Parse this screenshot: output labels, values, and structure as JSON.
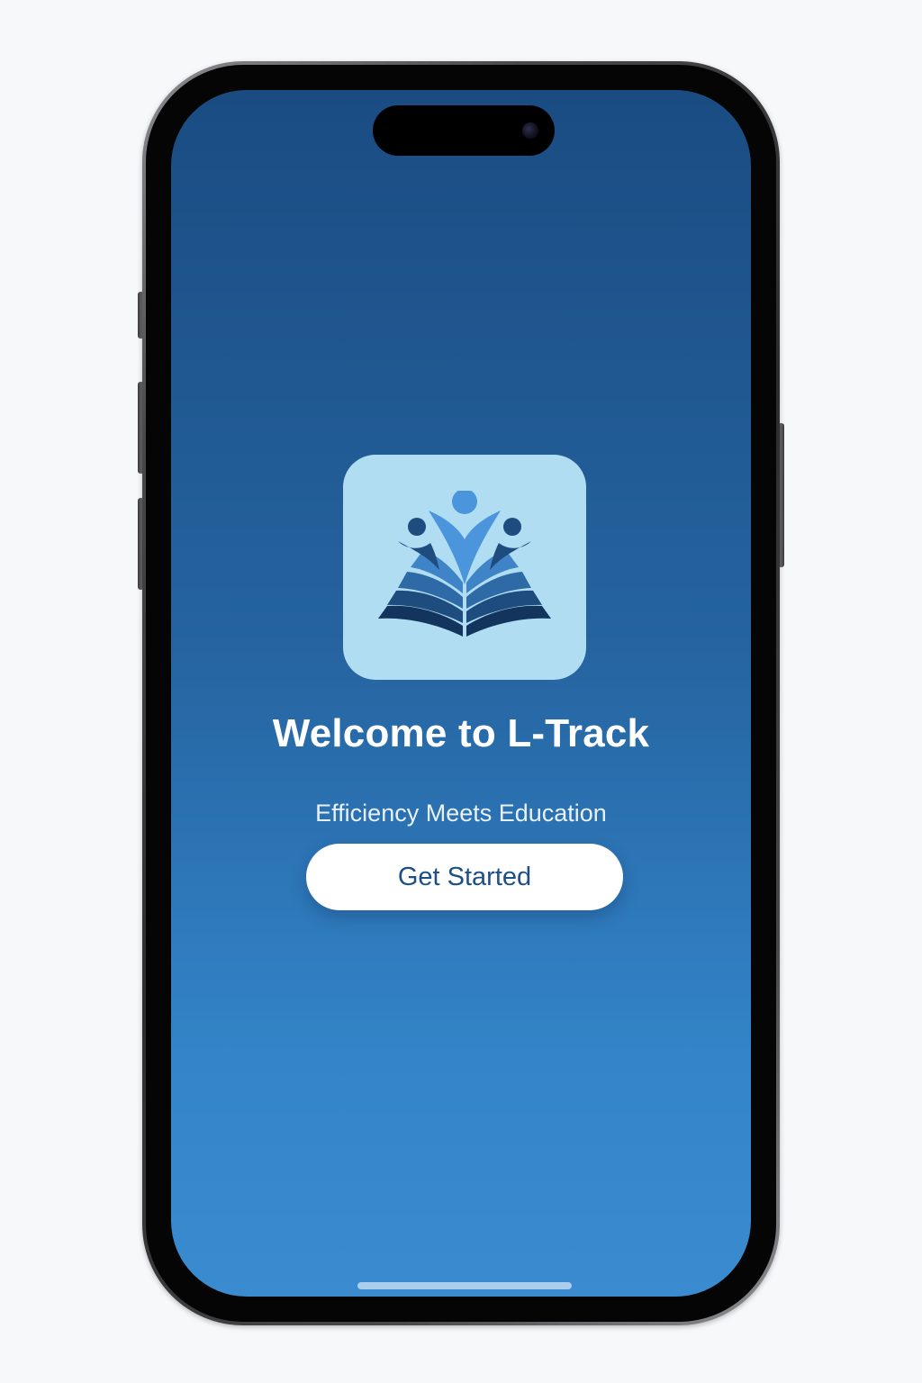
{
  "device": {
    "type": "smartphone",
    "icons": {
      "camera": "front-camera-icon",
      "home_indicator": "home-indicator"
    }
  },
  "screen": {
    "background_top": "#1a4c82",
    "background_bottom": "#3a8bd0"
  },
  "app_icon": {
    "name": "book-people-logo-icon",
    "background": "#b0ddf2"
  },
  "welcome": {
    "title": "Welcome to L-Track",
    "tagline": "Efficiency Meets Education"
  },
  "cta": {
    "label": "Get Started",
    "text_color": "#1d4f86"
  }
}
